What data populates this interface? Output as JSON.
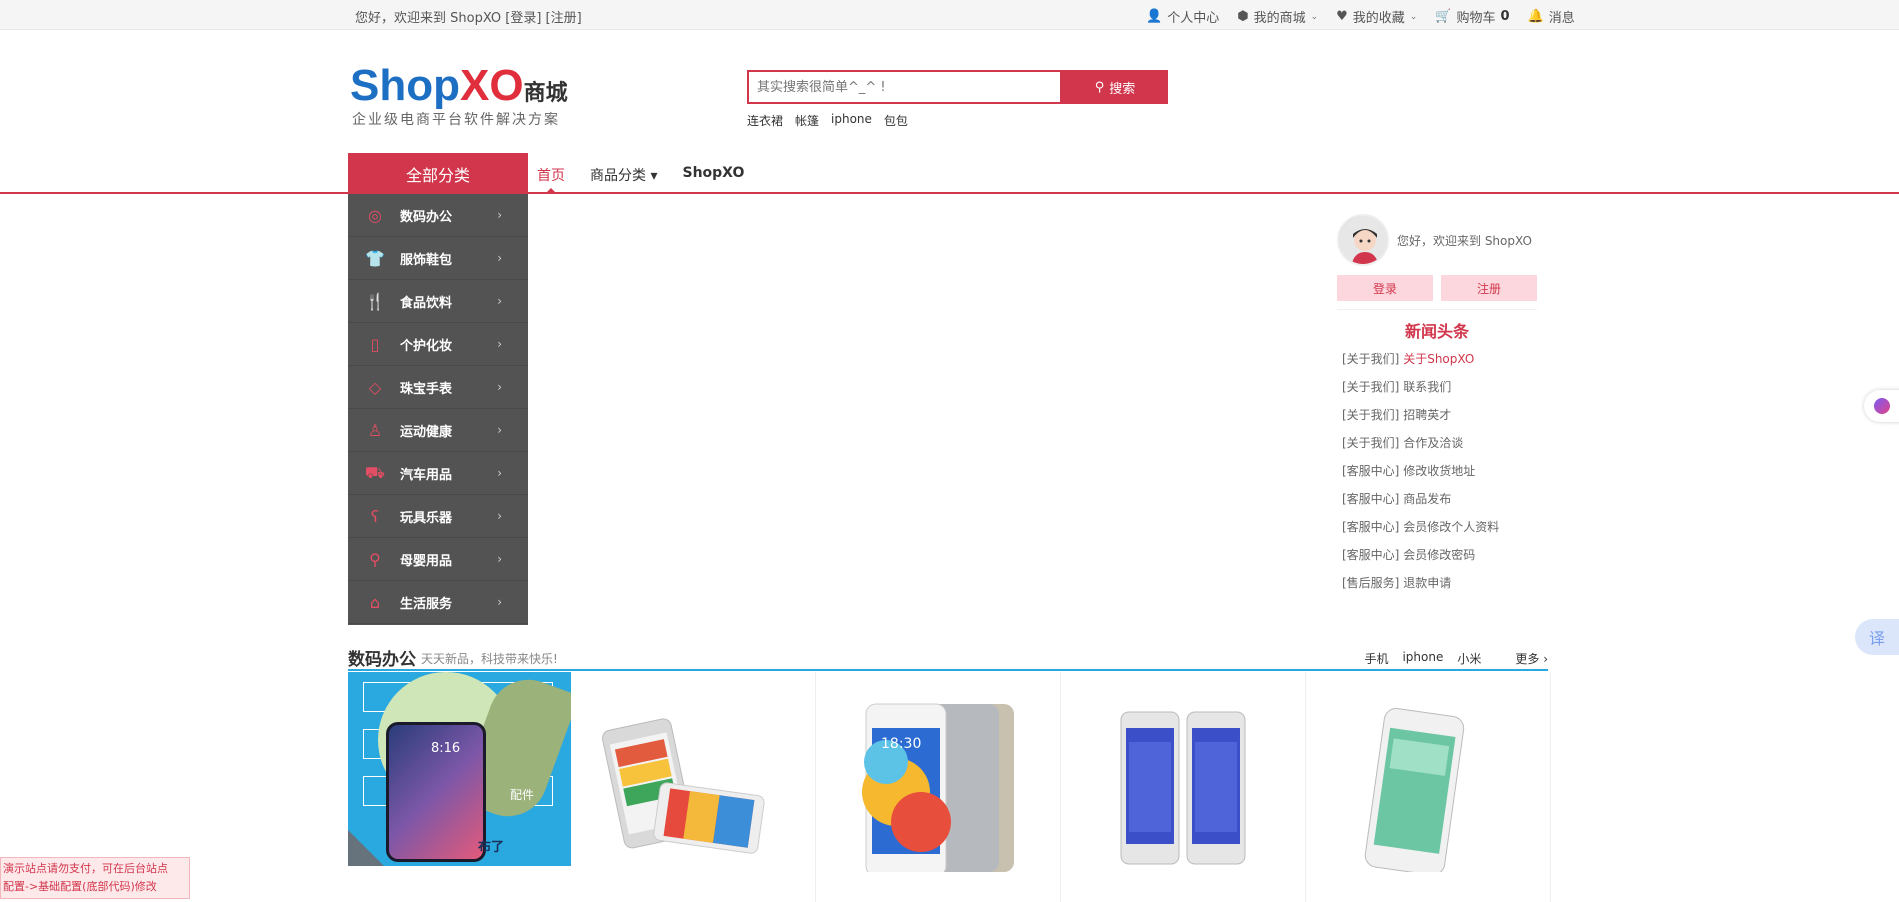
{
  "topbar": {
    "welcome": "您好，欢迎来到 ShopXO [登录] [注册]",
    "links": [
      {
        "label": "个人中心",
        "icon": "user-icon",
        "dropdown": false
      },
      {
        "label": "我的商城",
        "icon": "cube-icon",
        "dropdown": true
      },
      {
        "label": "我的收藏",
        "icon": "heart-icon",
        "dropdown": true
      },
      {
        "label": "购物车",
        "icon": "cart-icon",
        "count": "0"
      },
      {
        "label": "消息",
        "icon": "bell-icon"
      }
    ]
  },
  "logo": {
    "brand_a": "Shop",
    "brand_b": "XO",
    "suffix": "商城",
    "slogan": "企业级电商平台软件解决方案"
  },
  "search": {
    "placeholder": "其实搜索很简单^_^ !",
    "button_label": "搜索",
    "hot_words": [
      "连衣裙",
      "帐篷",
      "iphone",
      "包包"
    ]
  },
  "nav": {
    "all_categories": "全部分类",
    "items": [
      {
        "label": "首页",
        "active": true
      },
      {
        "label": "商品分类 ▾",
        "active": false
      },
      {
        "label": "ShopXO",
        "active": false
      }
    ]
  },
  "categories": [
    {
      "label": "数码办公",
      "icon": "camera-icon"
    },
    {
      "label": "服饰鞋包",
      "icon": "shirt-icon"
    },
    {
      "label": "食品饮料",
      "icon": "cutlery-icon"
    },
    {
      "label": "个护化妆",
      "icon": "bottle-icon"
    },
    {
      "label": "珠宝手表",
      "icon": "diamond-icon"
    },
    {
      "label": "运动健康",
      "icon": "runner-icon"
    },
    {
      "label": "汽车用品",
      "icon": "car-icon"
    },
    {
      "label": "玩具乐器",
      "icon": "bear-icon"
    },
    {
      "label": "母婴用品",
      "icon": "stroller-icon"
    },
    {
      "label": "生活服务",
      "icon": "home-icon"
    }
  ],
  "user_panel": {
    "welcome": "您好，欢迎来到 ShopXO",
    "login": "登录",
    "register": "注册"
  },
  "news": {
    "title": "新闻头条",
    "items": [
      {
        "tag": "[关于我们]",
        "text": "关于ShopXO",
        "highlight": true
      },
      {
        "tag": "[关于我们]",
        "text": "联系我们"
      },
      {
        "tag": "[关于我们]",
        "text": "招聘英才"
      },
      {
        "tag": "[关于我们]",
        "text": "合作及洽谈"
      },
      {
        "tag": "[客服中心]",
        "text": "修改收货地址"
      },
      {
        "tag": "[客服中心]",
        "text": "商品发布"
      },
      {
        "tag": "[客服中心]",
        "text": "会员修改个人资料"
      },
      {
        "tag": "[客服中心]",
        "text": "会员修改密码"
      },
      {
        "tag": "[售后服务]",
        "text": "退款申请"
      }
    ]
  },
  "floor": {
    "title": "数码办公",
    "subtitle": "天天新品，科技带来快乐!",
    "keywords": [
      "手机",
      "iphone",
      "小米"
    ],
    "more": "更多 ›",
    "banner_text_1": "布了",
    "banner_text_2": "配件"
  },
  "float": {
    "translate": "译"
  },
  "demo_note": {
    "line1": "演示站点请勿支付，可在后台站点",
    "line2": "配置->基础配置(底部代码)修改"
  },
  "colors": {
    "accent": "#d2364c",
    "floor_line": "#2aa8e0",
    "menu_bg": "#535353"
  }
}
